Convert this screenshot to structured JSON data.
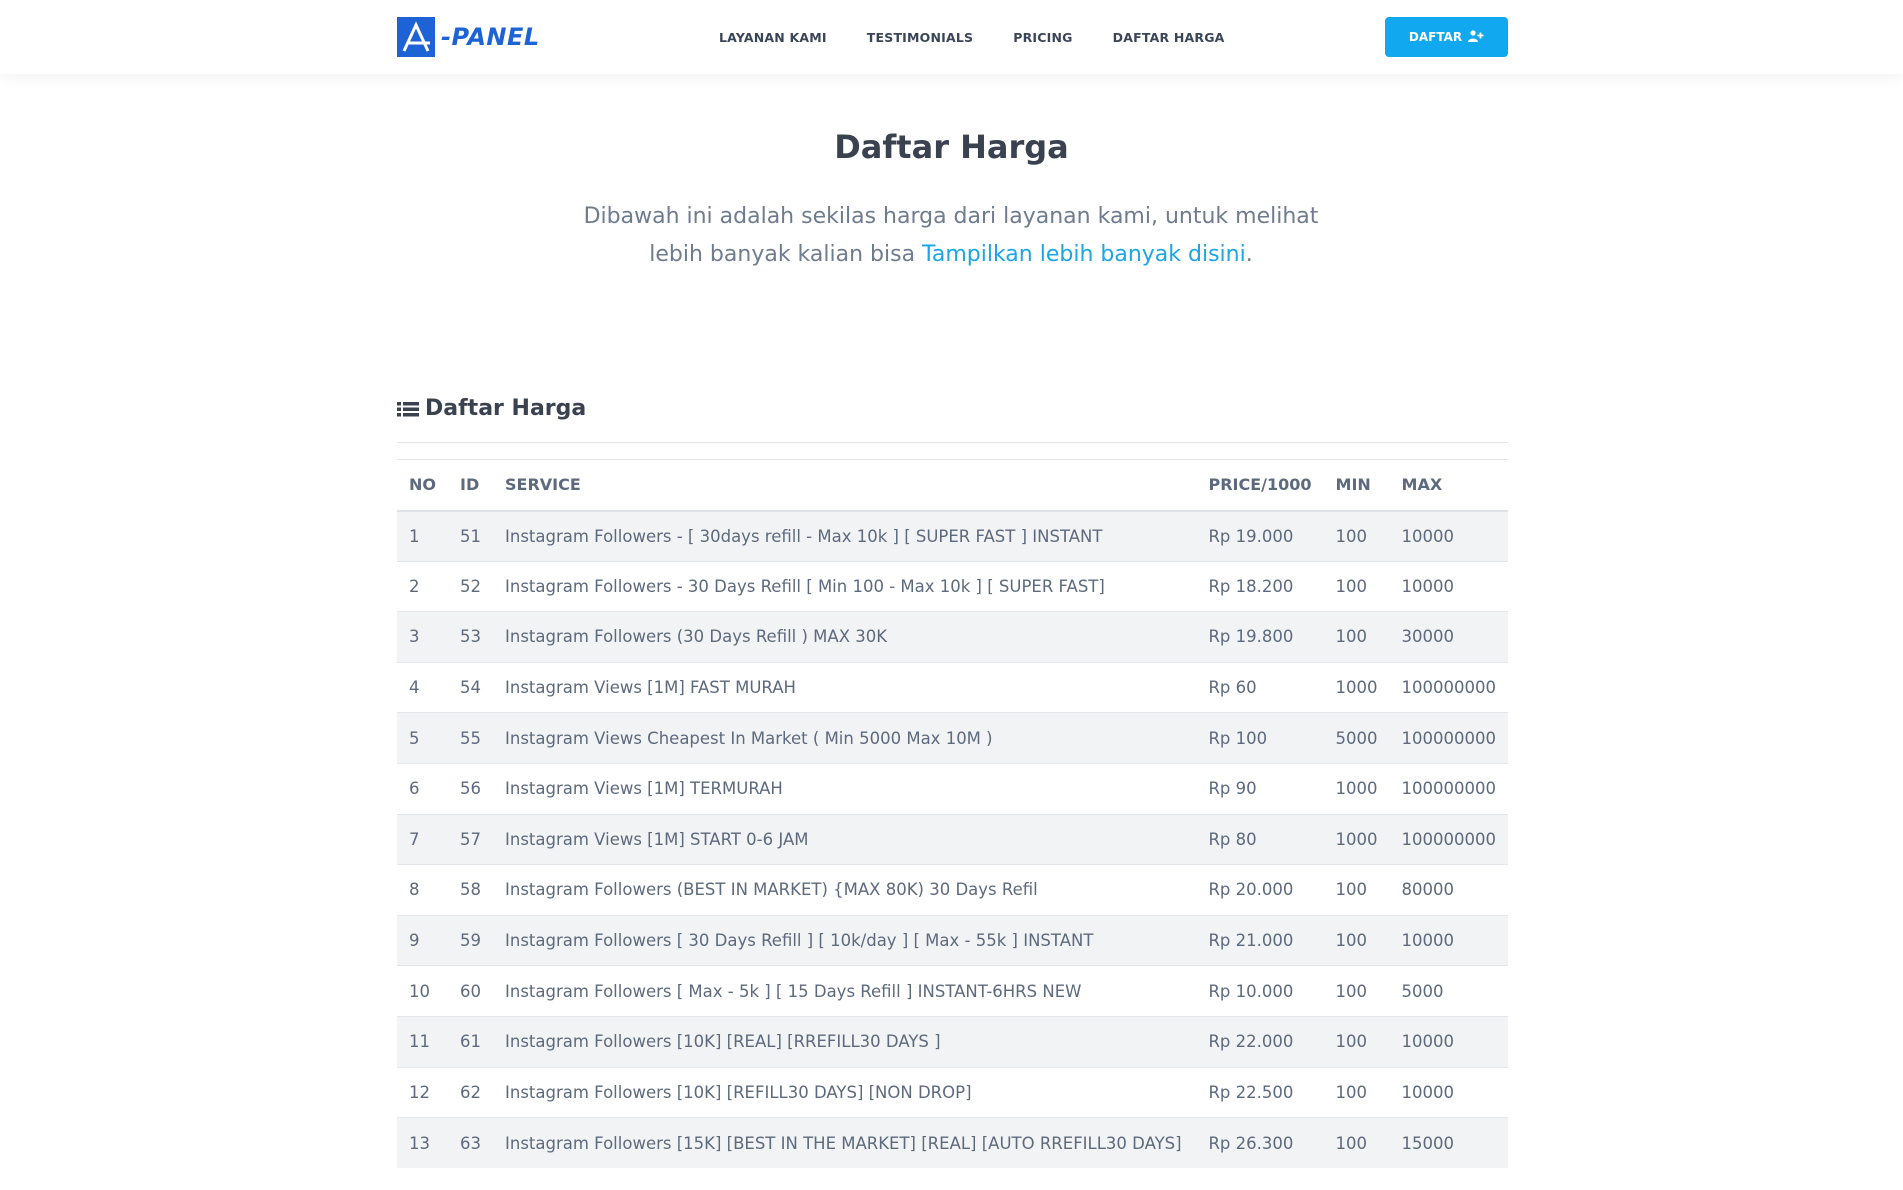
{
  "brand": {
    "logo_text": "-PANEL",
    "accent": "#1e63d6",
    "button_color": "#12a8f0"
  },
  "nav": {
    "links": [
      "LAYANAN KAMI",
      "TESTIMONIALS",
      "PRICING",
      "DAFTAR HARGA"
    ],
    "cta_label": "DAFTAR",
    "cta_icon": "user-plus-icon"
  },
  "hero": {
    "title": "Daftar Harga",
    "subtitle_line1": "Dibawah ini adalah sekilas harga dari layanan kami, untuk melihat",
    "subtitle_line2_prefix": "lebih banyak kalian bisa ",
    "subtitle_link": "Tampilkan lebih banyak disini",
    "subtitle_suffix": "."
  },
  "section": {
    "title": "Daftar Harga",
    "icon": "list-icon"
  },
  "table": {
    "headers": [
      "NO",
      "ID",
      "SERVICE",
      "PRICE/1000",
      "MIN",
      "MAX"
    ],
    "rows": [
      [
        "1",
        "51",
        "Instagram Followers - [ 30days refill - Max 10k ] [ SUPER FAST ] INSTANT",
        "Rp 19.000",
        "100",
        "10000"
      ],
      [
        "2",
        "52",
        "Instagram Followers - 30 Days Refill [ Min 100 - Max 10k ] [ SUPER FAST]",
        "Rp 18.200",
        "100",
        "10000"
      ],
      [
        "3",
        "53",
        "Instagram Followers (30 Days Refill ) MAX 30K",
        "Rp 19.800",
        "100",
        "30000"
      ],
      [
        "4",
        "54",
        "Instagram Views [1M] FAST MURAH",
        "Rp 60",
        "1000",
        "100000000"
      ],
      [
        "5",
        "55",
        "Instagram Views Cheapest In Market ( Min 5000 Max 10M )",
        "Rp 100",
        "5000",
        "100000000"
      ],
      [
        "6",
        "56",
        "Instagram Views [1M] TERMURAH",
        "Rp 90",
        "1000",
        "100000000"
      ],
      [
        "7",
        "57",
        "Instagram Views [1M] START 0-6 JAM",
        "Rp 80",
        "1000",
        "100000000"
      ],
      [
        "8",
        "58",
        "Instagram Followers (BEST IN MARKET) {MAX 80K) 30 Days Refil",
        "Rp 20.000",
        "100",
        "80000"
      ],
      [
        "9",
        "59",
        "Instagram Followers [ 30 Days Refill ] [ 10k/day ] [ Max - 55k ] INSTANT",
        "Rp 21.000",
        "100",
        "10000"
      ],
      [
        "10",
        "60",
        "Instagram Followers [ Max - 5k ] [ 15 Days Refill ] INSTANT-6HRS NEW",
        "Rp 10.000",
        "100",
        "5000"
      ],
      [
        "11",
        "61",
        "Instagram Followers [10K] [REAL] [RREFILL30 DAYS ]",
        "Rp 22.000",
        "100",
        "10000"
      ],
      [
        "12",
        "62",
        "Instagram Followers [10K] [REFILL30 DAYS] [NON DROP]",
        "Rp 22.500",
        "100",
        "10000"
      ],
      [
        "13",
        "63",
        "Instagram Followers [15K] [BEST IN THE MARKET] [REAL] [AUTO RREFILL30 DAYS]",
        "Rp 26.300",
        "100",
        "15000"
      ]
    ]
  }
}
